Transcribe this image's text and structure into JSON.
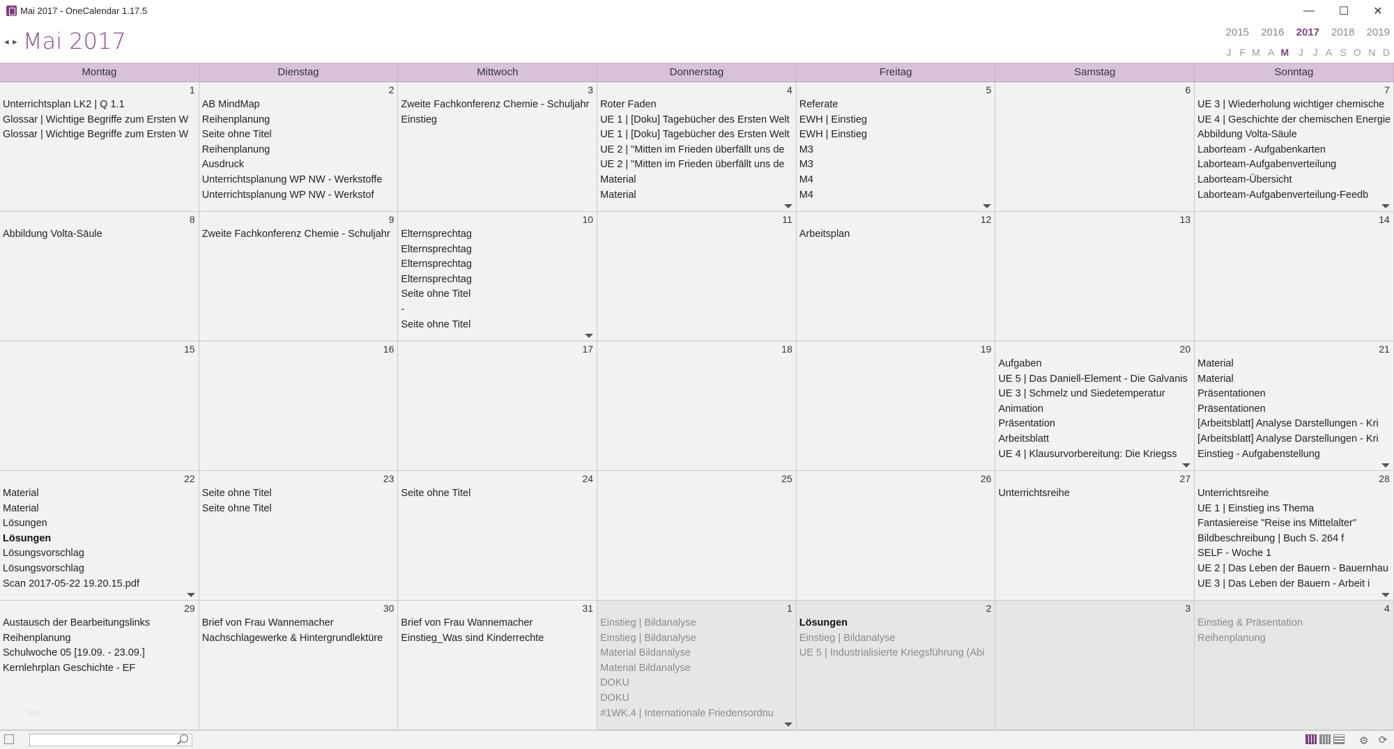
{
  "window": {
    "title": "Mai 2017 - OneCalendar 1.17.5",
    "min_glyph": "—",
    "max_glyph": "☐",
    "close_glyph": "✕"
  },
  "header": {
    "nav_arrows": "◂ ▸",
    "month_title": "Mai 2017",
    "years": [
      "2015",
      "2016",
      "2017",
      "2018",
      "2019"
    ],
    "active_year": "2017",
    "months": [
      "J",
      "F",
      "M",
      "A",
      "M",
      "J",
      "J",
      "A",
      "S",
      "O",
      "N",
      "D"
    ],
    "active_month_index": 4
  },
  "days": [
    "Montag",
    "Dienstag",
    "Mittwoch",
    "Donnerstag",
    "Freitag",
    "Samstag",
    "Sonntag"
  ],
  "weeks": [
    [
      {
        "num": "1",
        "other": false,
        "more": false,
        "items": [
          "Unterrichtsplan LK2 | Q 1.1",
          "Glossar | Wichtige Begriffe zum Ersten W",
          "Glossar | Wichtige Begriffe zum Ersten W"
        ]
      },
      {
        "num": "2",
        "other": false,
        "more": false,
        "items": [
          "AB MindMap",
          "Reihenplanung",
          "Seite ohne Titel",
          "Reihenplanung",
          "Ausdruck",
          "Unterrichtsplanung WP NW - Werkstoffe",
          "Unterrichtsplanung WP NW - Werkstof"
        ]
      },
      {
        "num": "3",
        "other": false,
        "more": false,
        "items": [
          "Zweite Fachkonferenz Chemie - Schuljahr",
          "Einstieg"
        ]
      },
      {
        "num": "4",
        "other": false,
        "more": true,
        "items": [
          "Roter Faden",
          "UE 1 | [Doku] Tagebücher des Ersten Welt",
          "UE 1 | [Doku] Tagebücher des Ersten Welt",
          "UE 2 | \"Mitten im Frieden überfällt uns de",
          "UE 2 | \"Mitten im Frieden überfällt uns de",
          "Material",
          "Material"
        ]
      },
      {
        "num": "5",
        "other": false,
        "more": true,
        "items": [
          "Referate",
          "EWH | Einstieg",
          "EWH | Einstieg",
          "M3",
          "M3",
          "M4",
          "M4"
        ]
      },
      {
        "num": "6",
        "other": false,
        "more": false,
        "items": []
      },
      {
        "num": "7",
        "other": false,
        "more": true,
        "items": [
          "UE 3 | Wiederholung wichtiger chemische",
          "UE 4 | Geschichte der chemischen Energie",
          "Abbildung Volta-Säule",
          "Laborteam - Aufgabenkarten",
          "Laborteam-Aufgabenverteilung",
          "Laborteam-Übersicht",
          "Laborteam-Aufgabenverteilung-Feedb"
        ]
      }
    ],
    [
      {
        "num": "8",
        "other": false,
        "more": false,
        "items": [
          "Abbildung Volta-Säule"
        ]
      },
      {
        "num": "9",
        "other": false,
        "more": false,
        "items": [
          "Zweite Fachkonferenz Chemie - Schuljahr"
        ]
      },
      {
        "num": "10",
        "other": false,
        "more": true,
        "items": [
          "Elternsprechtag",
          "Elternsprechtag",
          "Elternsprechtag",
          "Elternsprechtag",
          "Seite ohne Titel",
          "-",
          "Seite ohne Titel"
        ]
      },
      {
        "num": "11",
        "other": false,
        "more": false,
        "items": []
      },
      {
        "num": "12",
        "other": false,
        "more": false,
        "items": [
          "Arbeitsplan"
        ]
      },
      {
        "num": "13",
        "other": false,
        "more": false,
        "items": []
      },
      {
        "num": "14",
        "other": false,
        "more": false,
        "items": []
      }
    ],
    [
      {
        "num": "15",
        "other": false,
        "more": false,
        "items": []
      },
      {
        "num": "16",
        "other": false,
        "more": false,
        "items": []
      },
      {
        "num": "17",
        "other": false,
        "more": false,
        "items": []
      },
      {
        "num": "18",
        "other": false,
        "more": false,
        "items": []
      },
      {
        "num": "19",
        "other": false,
        "more": false,
        "items": []
      },
      {
        "num": "20",
        "other": false,
        "more": true,
        "items": [
          "Aufgaben",
          "UE 5 | Das Daniell-Element - Die Galvanis",
          "UE 3 | Schmelz und Siedetemperatur",
          "Animation",
          "Präsentation",
          "Arbeitsblatt",
          "UE 4 | Klausurvorbereitung: Die Kriegss"
        ]
      },
      {
        "num": "21",
        "other": false,
        "more": true,
        "items": [
          "Material",
          "Material",
          "Präsentationen",
          "Präsentationen",
          "[Arbeitsblatt] Analyse Darstellungen - Kri",
          "[Arbeitsblatt] Analyse Darstellungen - Kri",
          "Einstieg - Aufgabenstellung"
        ]
      }
    ],
    [
      {
        "num": "22",
        "other": false,
        "more": true,
        "items": [
          "Material",
          "Material",
          "Lösungen",
          "Lösungen",
          "Lösungsvorschlag",
          "Lösungsvorschlag",
          "Scan 2017-05-22 19.20.15.pdf"
        ],
        "bold_index": 3
      },
      {
        "num": "23",
        "other": false,
        "more": false,
        "items": [
          "Seite ohne Titel",
          "Seite ohne Titel"
        ]
      },
      {
        "num": "24",
        "other": false,
        "more": false,
        "items": [
          "Seite ohne Titel"
        ]
      },
      {
        "num": "25",
        "other": false,
        "more": false,
        "items": []
      },
      {
        "num": "26",
        "other": false,
        "more": false,
        "items": []
      },
      {
        "num": "27",
        "other": false,
        "more": false,
        "items": [
          "Unterrichtsreihe"
        ]
      },
      {
        "num": "28",
        "other": false,
        "more": true,
        "items": [
          "Unterrichtsreihe",
          "UE 1 | Einstieg ins Thema",
          "Fantasiereise \"Reise ins Mittelalter\"",
          "Bildbeschreibung | Buch S. 264 f",
          "SELF - Woche 1",
          "UE 2 | Das Leben der Bauern - Bauernhau",
          "UE 3 | Das Leben der Bauern - Arbeit i"
        ]
      }
    ],
    [
      {
        "num": "29",
        "other": false,
        "more": false,
        "items": [
          "Austausch der Bearbeitungslinks",
          "Reihenplanung",
          "Schulwoche 05 [19.09. - 23.09.]",
          "Kernlehrplan Geschichte - EF"
        ]
      },
      {
        "num": "30",
        "other": false,
        "more": false,
        "items": [
          "Brief von Frau Wannemacher",
          "Nachschlagewerke & Hintergrundlektüre"
        ]
      },
      {
        "num": "31",
        "other": false,
        "more": false,
        "items": [
          "Brief von Frau Wannemacher",
          "Einstieg_Was sind Kinderrechte"
        ]
      },
      {
        "num": "1",
        "other": true,
        "more": true,
        "items": [
          "Einstieg | Bildanalyse",
          "Einstieg | Bildanalyse",
          "Material Bildanalyse",
          "Material Bildanalyse",
          "DOKU",
          "DOKU",
          "#1WK.4 | Internationale Friedensordnu"
        ]
      },
      {
        "num": "2",
        "other": true,
        "more": false,
        "items": [
          "Lösungen",
          "Einstieg | Bildanalyse",
          "UE 5 | Industrialisierte Kriegsführung (Abi"
        ],
        "bold_index": 0
      },
      {
        "num": "3",
        "other": true,
        "more": false,
        "items": []
      },
      {
        "num": "4",
        "other": true,
        "more": false,
        "items": [
          "Einstieg & Präsentation",
          "Reihenplanung"
        ]
      }
    ]
  ],
  "statusbar": {
    "search_placeholder": "",
    "faint_label": "Nop",
    "gear_glyph": "⚙",
    "sync_glyph": "⟳"
  },
  "colors": {
    "accent": "#8a4b8d",
    "dayname_bg": "#d9c2d9",
    "other_month_bg": "#e6e6e6"
  }
}
